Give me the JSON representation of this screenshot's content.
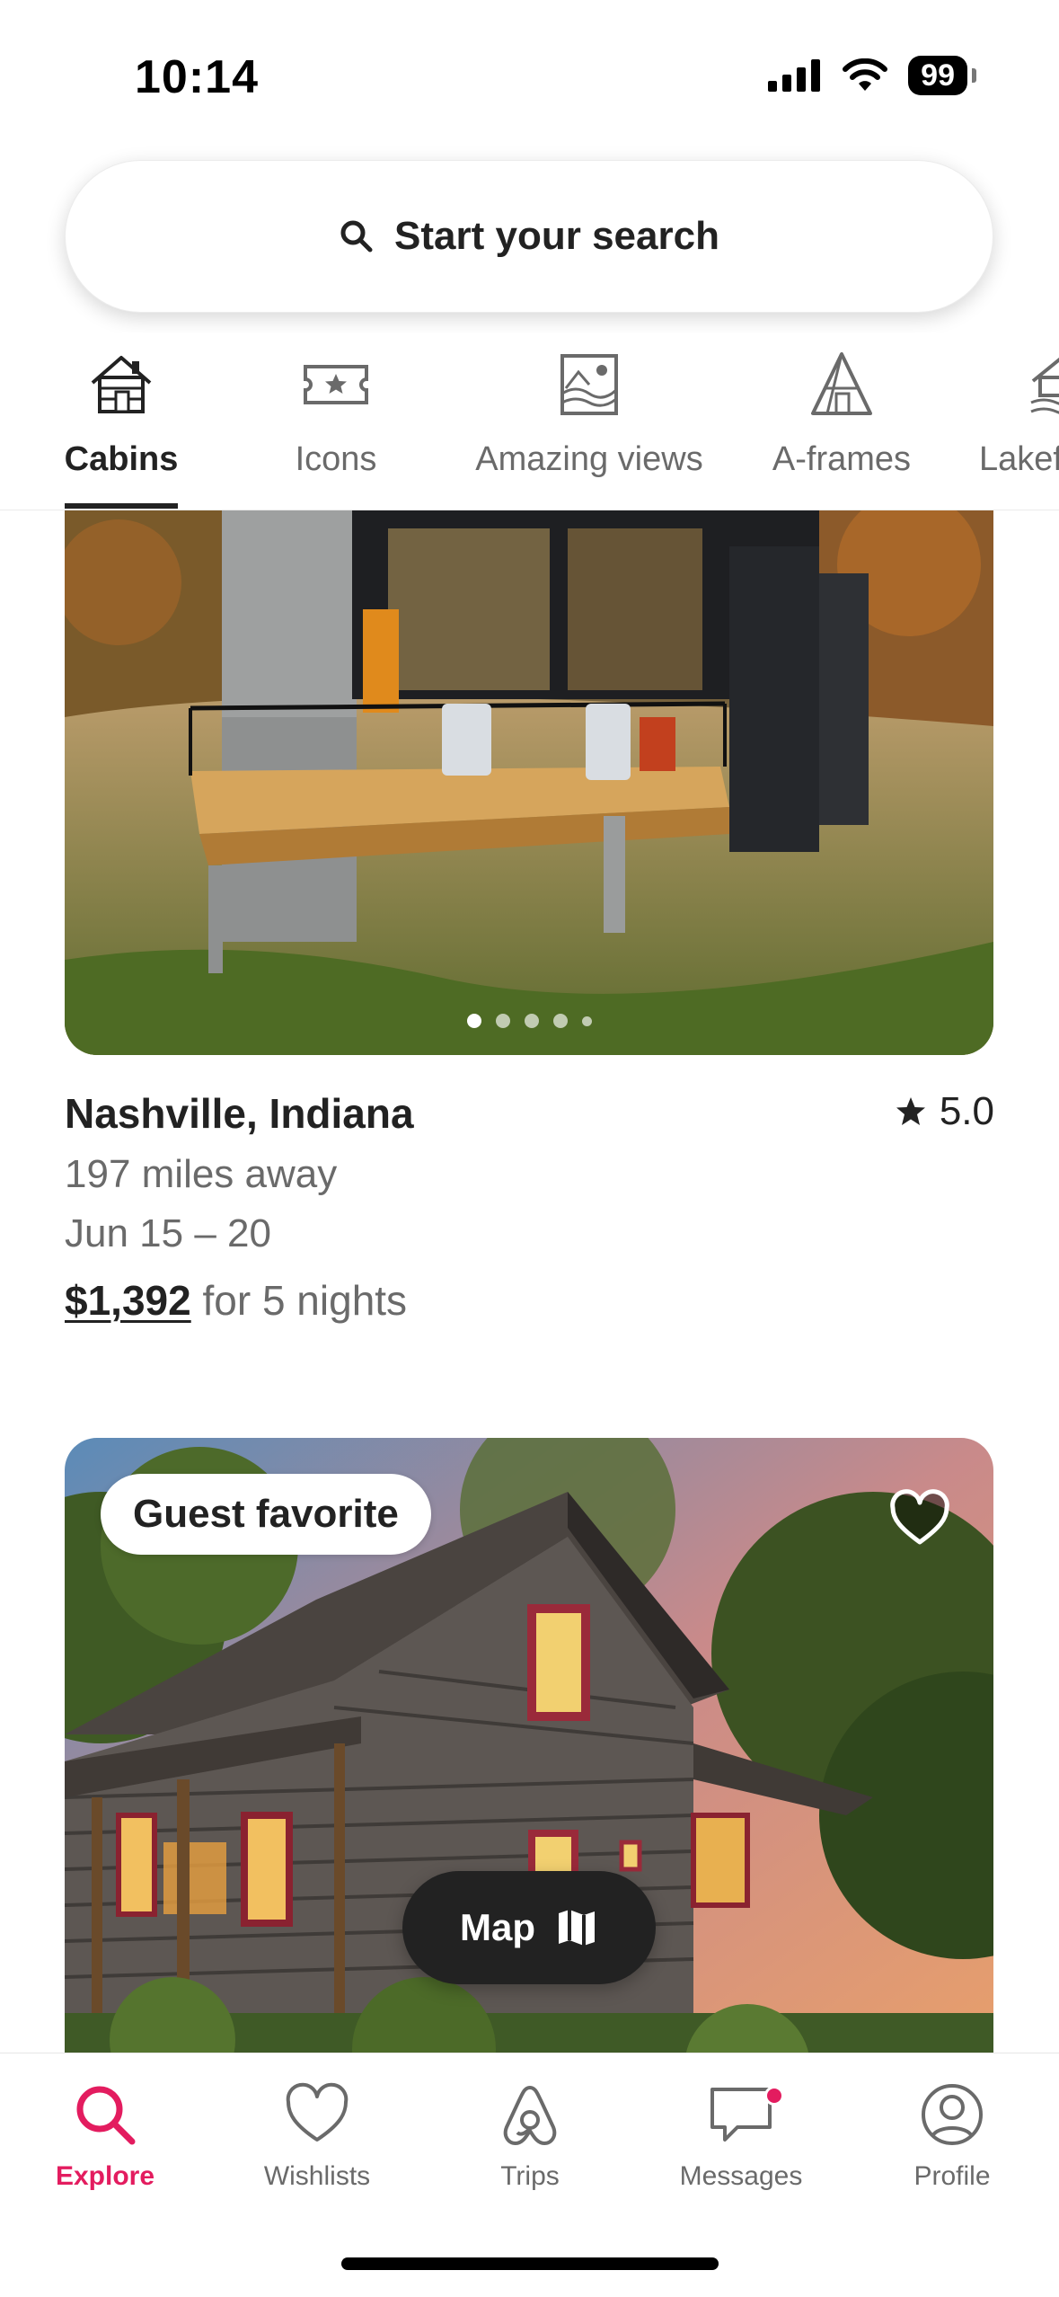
{
  "status_bar": {
    "time": "10:14",
    "battery": "99"
  },
  "search": {
    "label": "Start your search"
  },
  "categories": [
    {
      "label": "Cabins",
      "icon": "cabin-icon",
      "active": true
    },
    {
      "label": "Icons",
      "icon": "ticket-star-icon",
      "active": false
    },
    {
      "label": "Amazing views",
      "icon": "landscape-frame-icon",
      "active": false
    },
    {
      "label": "A-frames",
      "icon": "a-frame-icon",
      "active": false
    },
    {
      "label": "Lakefront",
      "icon": "lake-house-icon",
      "active": false
    }
  ],
  "listing1": {
    "location": "Nashville, Indiana",
    "rating": "5.0",
    "distance": "197 miles away",
    "dates": "Jun 15 – 20",
    "price": "$1,392",
    "price_suffix": "for 5 nights",
    "photo_count": 5,
    "active_photo": 1
  },
  "listing2": {
    "badge": "Guest favorite"
  },
  "map_button": {
    "label": "Map"
  },
  "nav": {
    "items": [
      {
        "label": "Explore",
        "icon": "search-icon",
        "active": true
      },
      {
        "label": "Wishlists",
        "icon": "heart-icon",
        "active": false
      },
      {
        "label": "Trips",
        "icon": "airbnb-logo-icon",
        "active": false
      },
      {
        "label": "Messages",
        "icon": "message-icon",
        "active": false,
        "notification": true
      },
      {
        "label": "Profile",
        "icon": "profile-icon",
        "active": false
      }
    ]
  },
  "colors": {
    "accent": "#E31C5F",
    "text": "#222222",
    "muted": "#6A6A6A"
  }
}
